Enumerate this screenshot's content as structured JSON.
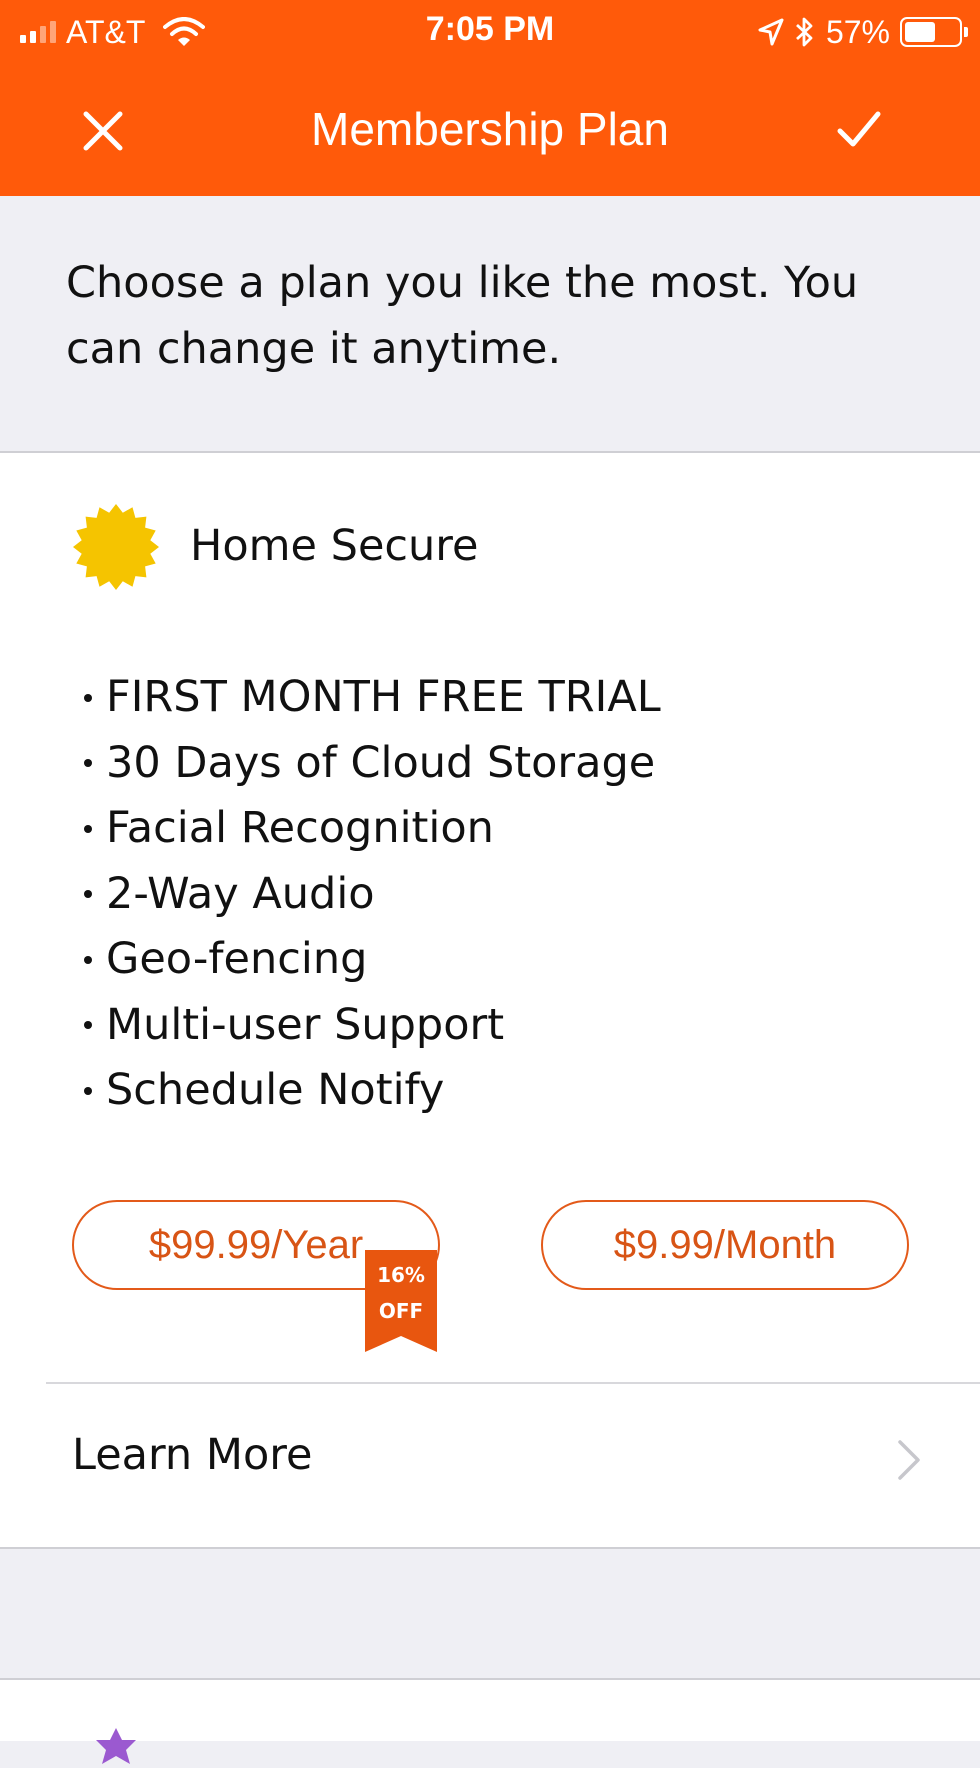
{
  "status_bar": {
    "carrier": "AT&T",
    "time": "7:05 PM",
    "battery_percent": "57%",
    "battery_level": 0.57,
    "signal_bars_filled": 2,
    "signal_bars_total": 4
  },
  "nav": {
    "title": "Membership Plan",
    "close_icon": "close-icon",
    "confirm_icon": "checkmark-icon"
  },
  "intro_text": "Choose a plan you like the most. You can change it anytime.",
  "plan": {
    "name": "Home Secure",
    "icon": "sun-badge-icon",
    "features": [
      "FIRST MONTH FREE TRIAL",
      "30 Days of Cloud Storage",
      "Facial Recognition",
      "2-Way Audio",
      "Geo-fencing",
      "Multi-user Support",
      "Schedule Notify"
    ],
    "price_yearly": "$99.99/Year",
    "price_monthly": "$9.99/Month",
    "discount_percent": "16%",
    "discount_label": "OFF"
  },
  "learn_more": {
    "label": "Learn More"
  },
  "colors": {
    "accent": "#ff5a0a",
    "price_text": "#d85415",
    "badge_yellow": "#f5c400",
    "next_badge_purple": "#9b59d0"
  }
}
